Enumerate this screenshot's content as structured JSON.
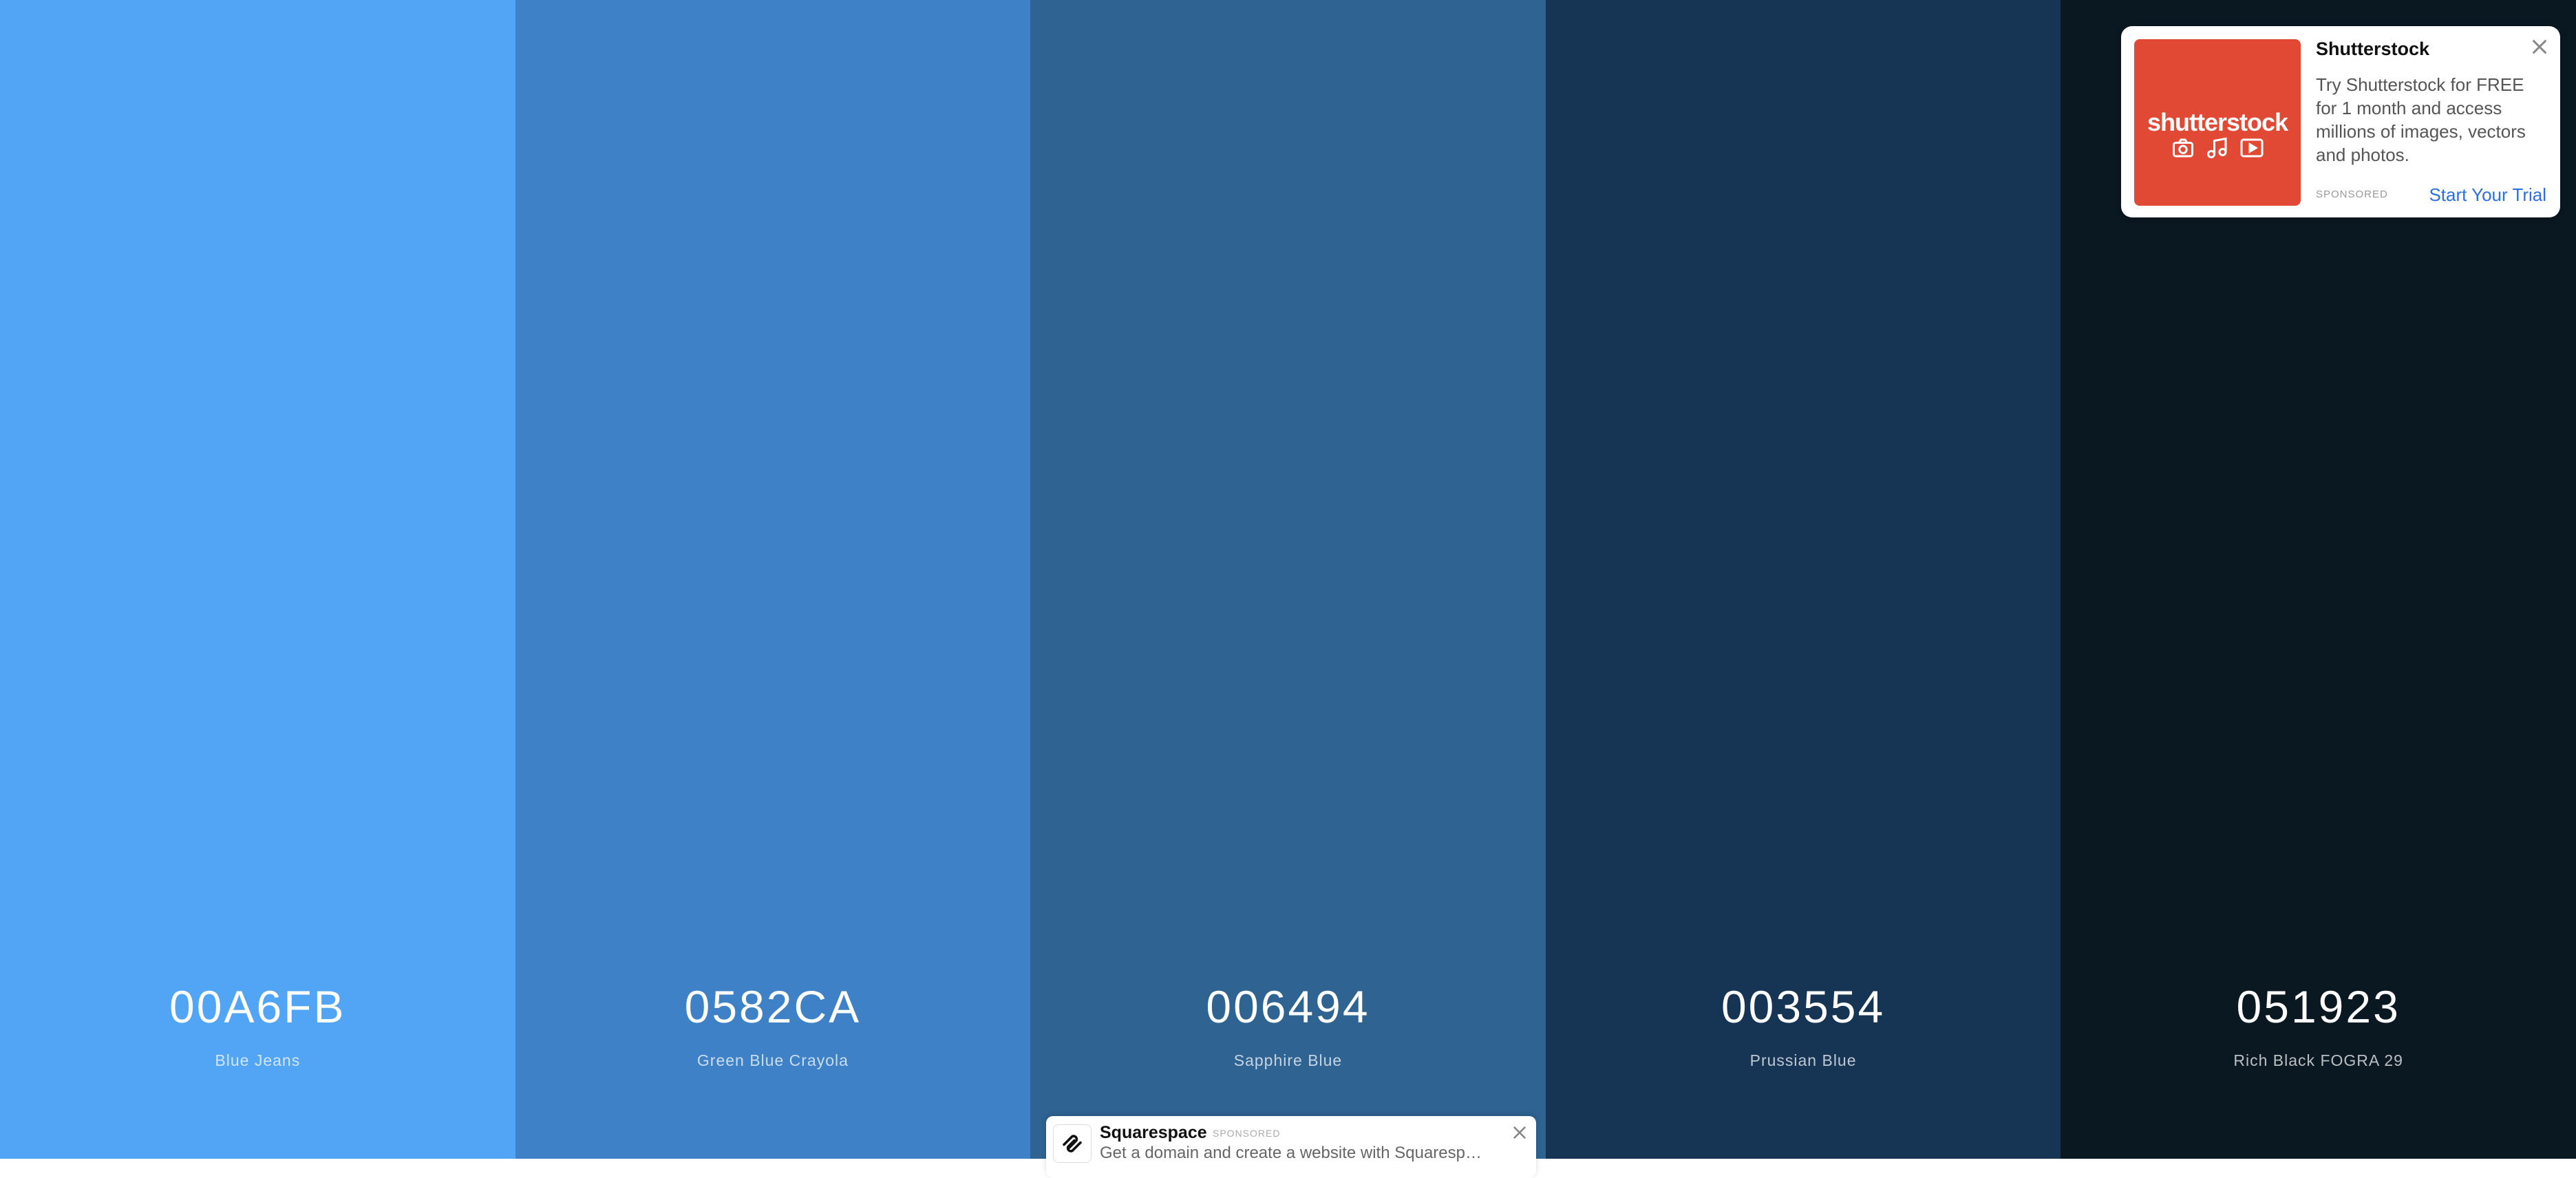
{
  "palette": {
    "colors": [
      {
        "hex": "00A6FB",
        "name": "Blue Jeans",
        "color": "#52a5f5"
      },
      {
        "hex": "0582CA",
        "name": "Green Blue Crayola",
        "color": "#3e81c6"
      },
      {
        "hex": "006494",
        "name": "Sapphire Blue",
        "color": "#2e6392"
      },
      {
        "hex": "003554",
        "name": "Prussian Blue",
        "color": "#163454"
      },
      {
        "hex": "051923",
        "name": "Rich Black FOGRA 29",
        "color": "#0a1822"
      }
    ]
  },
  "ad": {
    "logo_text": "shutterstock",
    "title": "Shutterstock",
    "body": "Try Shutterstock for FREE for 1 month and access millions of images, vectors and photos.",
    "sponsored_label": "SPONSORED",
    "cta": "Start Your Trial",
    "brand_color": "#e14934",
    "cta_color": "#2d6fe0"
  },
  "banner": {
    "title": "Squarespace",
    "sponsored_label": "SPONSORED",
    "text": "Get a domain and create a website with Squarespa..."
  }
}
